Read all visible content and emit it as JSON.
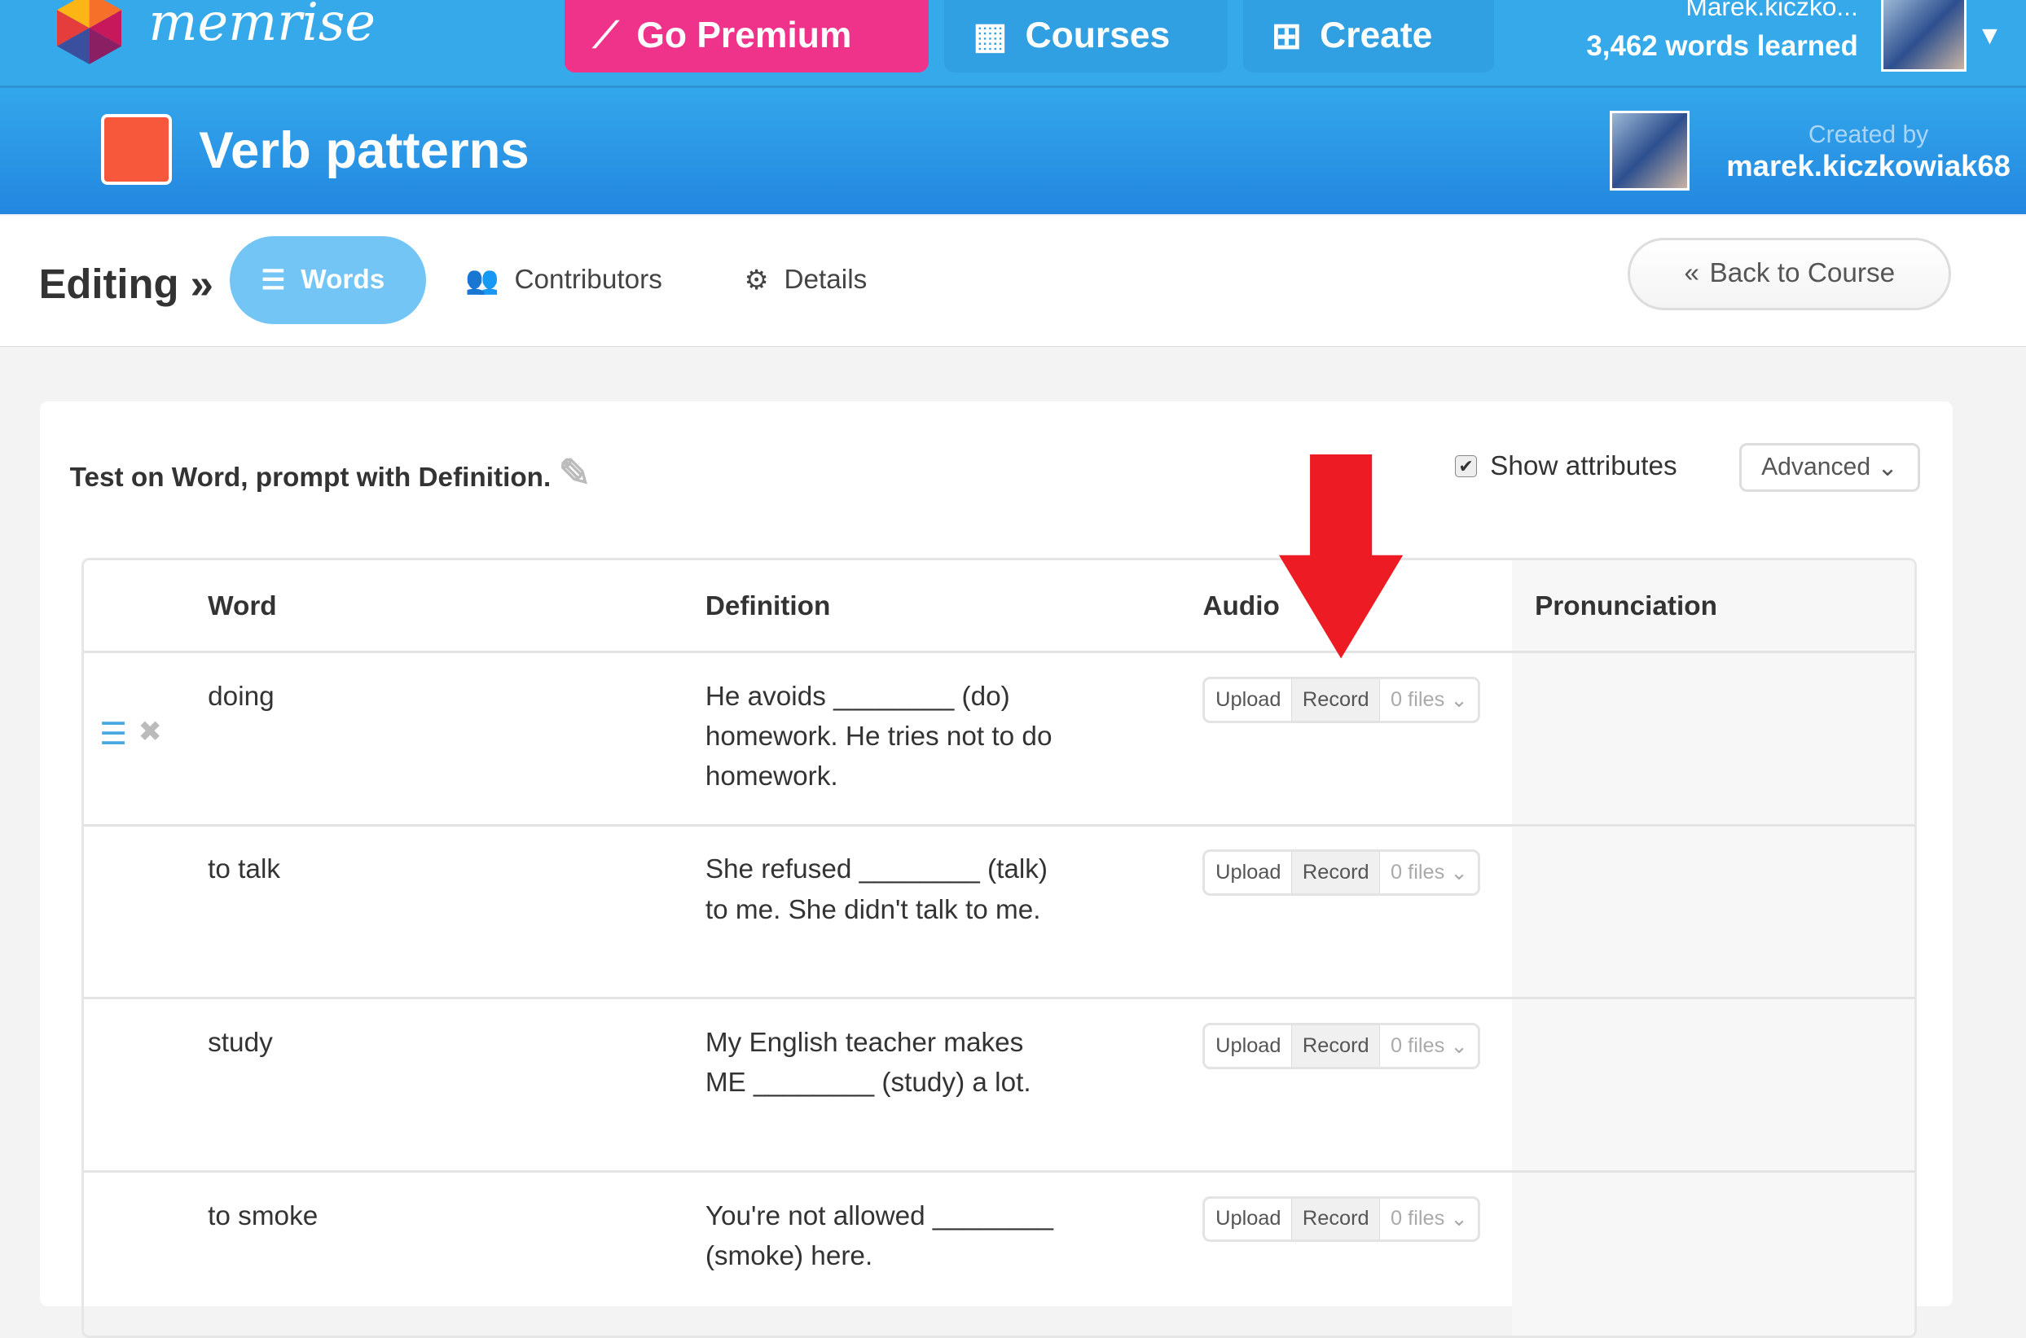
{
  "topbar": {
    "brand": "memrise",
    "go_premium": "Go Premium",
    "courses": "Courses",
    "create": "Create",
    "username": "Marek.kiczko...",
    "words_learned": "3,462 words learned"
  },
  "header": {
    "course_title": "Verb patterns",
    "created_by_label": "Created by",
    "creator": "marek.kiczkowiak68"
  },
  "subnav": {
    "editing": "Editing »",
    "tabs": [
      {
        "label": "Words",
        "active": true
      },
      {
        "label": "Contributors"
      },
      {
        "label": "Details"
      }
    ],
    "back": "Back to Course"
  },
  "panel": {
    "test_text": "Test on Word, prompt with Definition.",
    "show_attributes": "Show attributes",
    "show_attributes_checked": true,
    "advanced": "Advanced"
  },
  "table": {
    "headers": [
      "Word",
      "Definition",
      "Audio",
      "Pronunciation"
    ],
    "rows": [
      {
        "word": "doing",
        "definition": "He avoids ________ (do) homework. He tries not to do homework.",
        "upload": "Upload",
        "record": "Record",
        "files": "0 files"
      },
      {
        "word": "to talk",
        "definition": "She refused ________ (talk) to me. She didn't talk to me.",
        "upload": "Upload",
        "record": "Record",
        "files": "0 files"
      },
      {
        "word": "study",
        "definition": "My English teacher makes ME ________ (study) a lot.",
        "upload": "Upload",
        "record": "Record",
        "files": "0 files"
      },
      {
        "word": "to smoke",
        "definition": "You're not allowed ________ (smoke) here.",
        "upload": "Upload",
        "record": "Record",
        "files": "0 files"
      }
    ]
  },
  "colors": {
    "topbar": "#35a9ea",
    "premium": "#f0338a",
    "active_tab": "#72c5f5",
    "annotation_arrow": "#ed1c24"
  }
}
